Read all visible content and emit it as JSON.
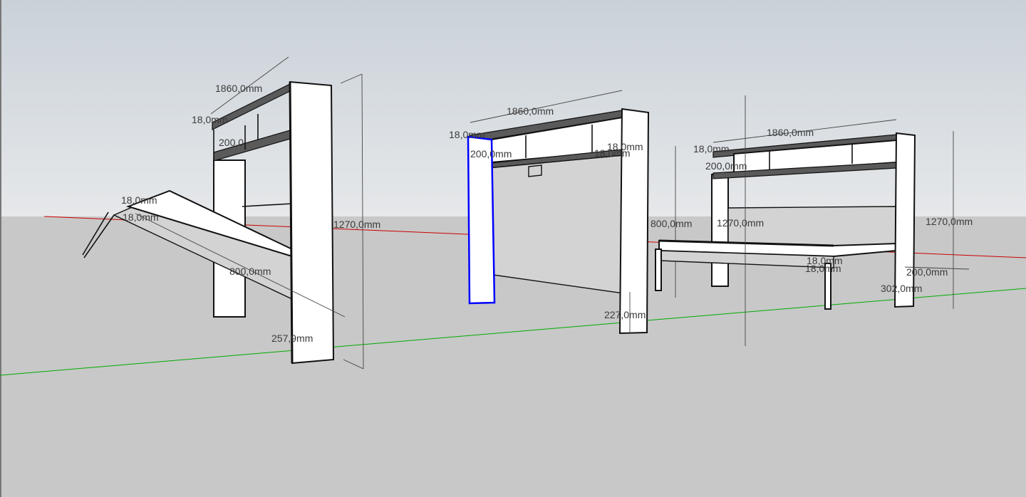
{
  "viewport": {
    "sky_top": "#c9d1d8",
    "sky_bottom": "#e6e8ea",
    "ground": "#c8c8c8",
    "axis_red": "#cc0000",
    "axis_green": "#00aa00",
    "selection": "#0000ff"
  },
  "model_left": {
    "dim_width": "1860,0mm",
    "dim_shelf_thickness": "18,0mm",
    "dim_shelf_depth": "200,0",
    "dim_height": "1270,0mm",
    "dim_bed_depth": "800,0mm",
    "dim_leg": "257,9mm",
    "dim_frame_a": "18,0mm",
    "dim_frame_b": "18,0mm"
  },
  "model_middle": {
    "dim_width": "1860,0mm",
    "dim_shelf_thickness": "18,0mm",
    "dim_shelf_depth": "200,0mm",
    "dim_top_a": "18,0mm",
    "dim_top_b": "18,0mm",
    "dim_bed_depth": "800,0mm",
    "dim_base": "227,0mm"
  },
  "model_right": {
    "dim_width": "1860,0mm",
    "dim_shelf_thickness": "18,0mm",
    "dim_shelf_depth": "200,0mm",
    "dim_height_center": "1270,0mm",
    "dim_height_right": "1270,0mm",
    "dim_frame_a": "18,0mm",
    "dim_frame_b": "18,0mm",
    "dim_depth": "200,0mm",
    "dim_leg": "302,0mm"
  }
}
